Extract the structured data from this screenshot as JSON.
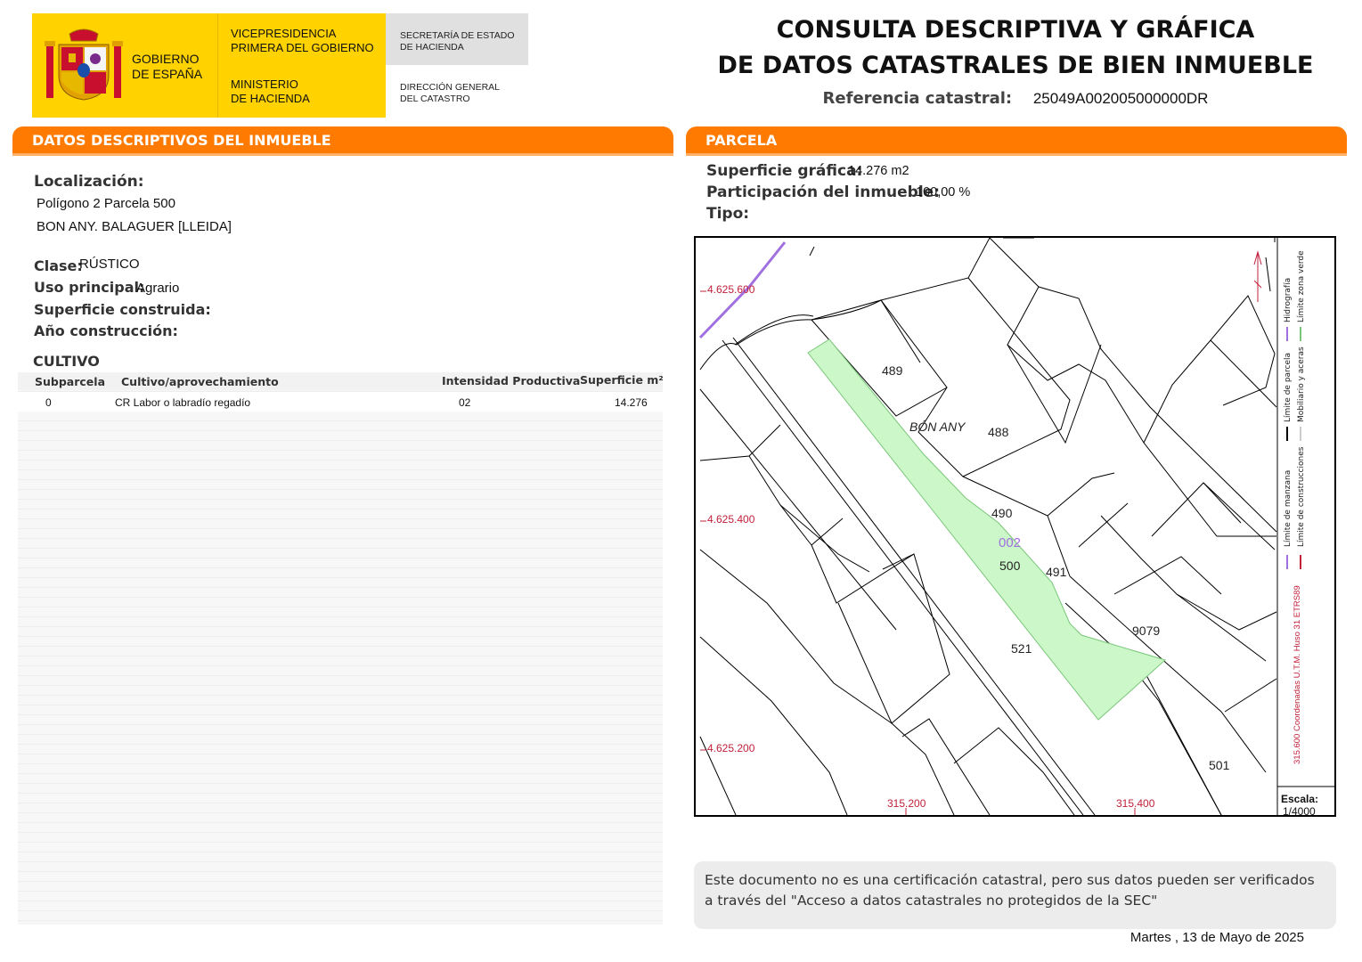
{
  "header": {
    "gobierno": [
      "GOBIERNO",
      "DE ESPAÑA"
    ],
    "vicepresidencia": [
      "VICEPRESIDENCIA",
      "PRIMERA DEL GOBIERNO"
    ],
    "ministerio": [
      "MINISTERIO",
      "DE HACIENDA"
    ],
    "secretaria": [
      "SECRETARÍA DE ESTADO",
      "DE HACIENDA"
    ],
    "direccion": [
      "DIRECCIÓN GENERAL",
      "DEL CATASTRO"
    ],
    "title_line1": "CONSULTA DESCRIPTIVA Y GRÁFICA",
    "title_line2": "DE DATOS CATASTRALES DE BIEN INMUEBLE",
    "ref_label": "Referencia catastral:",
    "ref_value": "25049A002005000000DR"
  },
  "descriptivos": {
    "heading": "DATOS DESCRIPTIVOS DEL INMUEBLE",
    "localizacion_label": "Localización:",
    "localizacion_line1": "Polígono 2 Parcela 500",
    "localizacion_line2": "BON ANY. BALAGUER [LLEIDA]",
    "clase_label": "Clase:",
    "clase_value": "RÚSTICO",
    "uso_label": "Uso principal:",
    "uso_value": "Agrario",
    "superficie_label": "Superficie construida:",
    "anio_label": "Año construcción:",
    "cultivo_heading": "CULTIVO",
    "table": {
      "headers": [
        "Subparcela",
        "Cultivo/aprovechamiento",
        "Intensidad Productiva",
        "Superficie m²"
      ],
      "rows": [
        [
          "0",
          "CR Labor o labradío regadío",
          "02",
          "14.276"
        ]
      ]
    }
  },
  "parcela": {
    "heading": "PARCELA",
    "superficie_label": "Superficie gráfica:",
    "superficie_value": "14.276 m2",
    "participacion_label": "Participación del inmueble:",
    "participacion_value": "100,00 %",
    "tipo_label": "Tipo:"
  },
  "map": {
    "coords_y": [
      "4.625.600",
      "4.625.400",
      "4.625.200"
    ],
    "coords_x": [
      "315.200",
      "315.400"
    ],
    "parcel_labels": [
      "489",
      "488",
      "490",
      "500",
      "491",
      "521",
      "9079",
      "501"
    ],
    "place_name": "BÓN ANY",
    "poligono_label": "002",
    "legend": [
      "Límite de manzana",
      "Límite de parcela",
      "Hidrografía",
      "Límite de construcciones",
      "Mobiliario y aceras",
      "Límite zona verde"
    ],
    "coord_system": "315.600 Coordenadas U.T.M. Huso 31 ETRS89",
    "escala_label": "Escala:",
    "escala_value": "1/4000",
    "colors": {
      "parcel_fill": "#ccf7c8",
      "parcel_stroke": "#7ac77a",
      "coord": "#c0203a",
      "hydro": "#a070e0"
    }
  },
  "footer": {
    "note": "Este documento no es una certificación catastral, pero sus datos pueden ser verificados a través del \"Acceso a datos catastrales no protegidos de la SEC\"",
    "date": "Martes , 13 de Mayo de 2025"
  }
}
